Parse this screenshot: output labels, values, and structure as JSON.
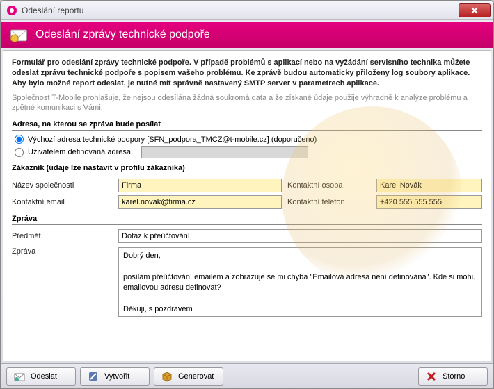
{
  "window": {
    "title": "Odeslání reportu"
  },
  "banner": {
    "title": "Odeslání zprávy technické podpoře"
  },
  "intro": {
    "bold": "Formulář pro odeslání zprávy technické podpoře. V případě problémů s aplikací nebo na vyžádání servisního technika můžete odeslat zprávu technické podpoře s popisem vašeho problému. Ke zprávě budou automaticky přiloženy log soubory aplikace. Aby bylo možné report odeslat, je nutné mít správně nastavený SMTP server v parametrech aplikace.",
    "light": "Společnost T-Mobile prohlašuje, že nejsou odesílána žádná soukromá data a že získané údaje použije výhradně k analýze problému a zpětné komunikaci s Vámi."
  },
  "address": {
    "heading": "Adresa, na kterou se zpráva bude posílat",
    "opt_default": "Výchozí adresa technické podpory [SFN_podpora_TMCZ@t-mobile.cz] (doporučeno)",
    "opt_custom": "Uživatelem definovaná adresa:",
    "custom_value": ""
  },
  "customer": {
    "heading": "Zákazník (údaje lze nastavit v profilu zákazníka)",
    "company_label": "Název společnosti",
    "company_value": "Firma",
    "person_label": "Kontaktní osoba",
    "person_value": "Karel Novák",
    "email_label": "Kontaktní email",
    "email_value": "karel.novak@firma.cz",
    "phone_label": "Kontaktní telefon",
    "phone_value": "+420 555 555 555"
  },
  "message": {
    "heading": "Zpráva",
    "subject_label": "Předmět",
    "subject_value": "Dotaz k přeúčtování",
    "body_label": "Zpráva",
    "body_value": "Dobrý den,\n\nposílám přeúčtování emailem a zobrazuje se mi chyba \"Emailová adresa není definována\". Kde si mohu emailovou adresu definovat?\n\nDěkuji, s pozdravem\nKarel Kovák"
  },
  "buttons": {
    "send": "Odeslat",
    "create": "Vytvořit",
    "generate": "Generovat",
    "cancel": "Storno"
  }
}
